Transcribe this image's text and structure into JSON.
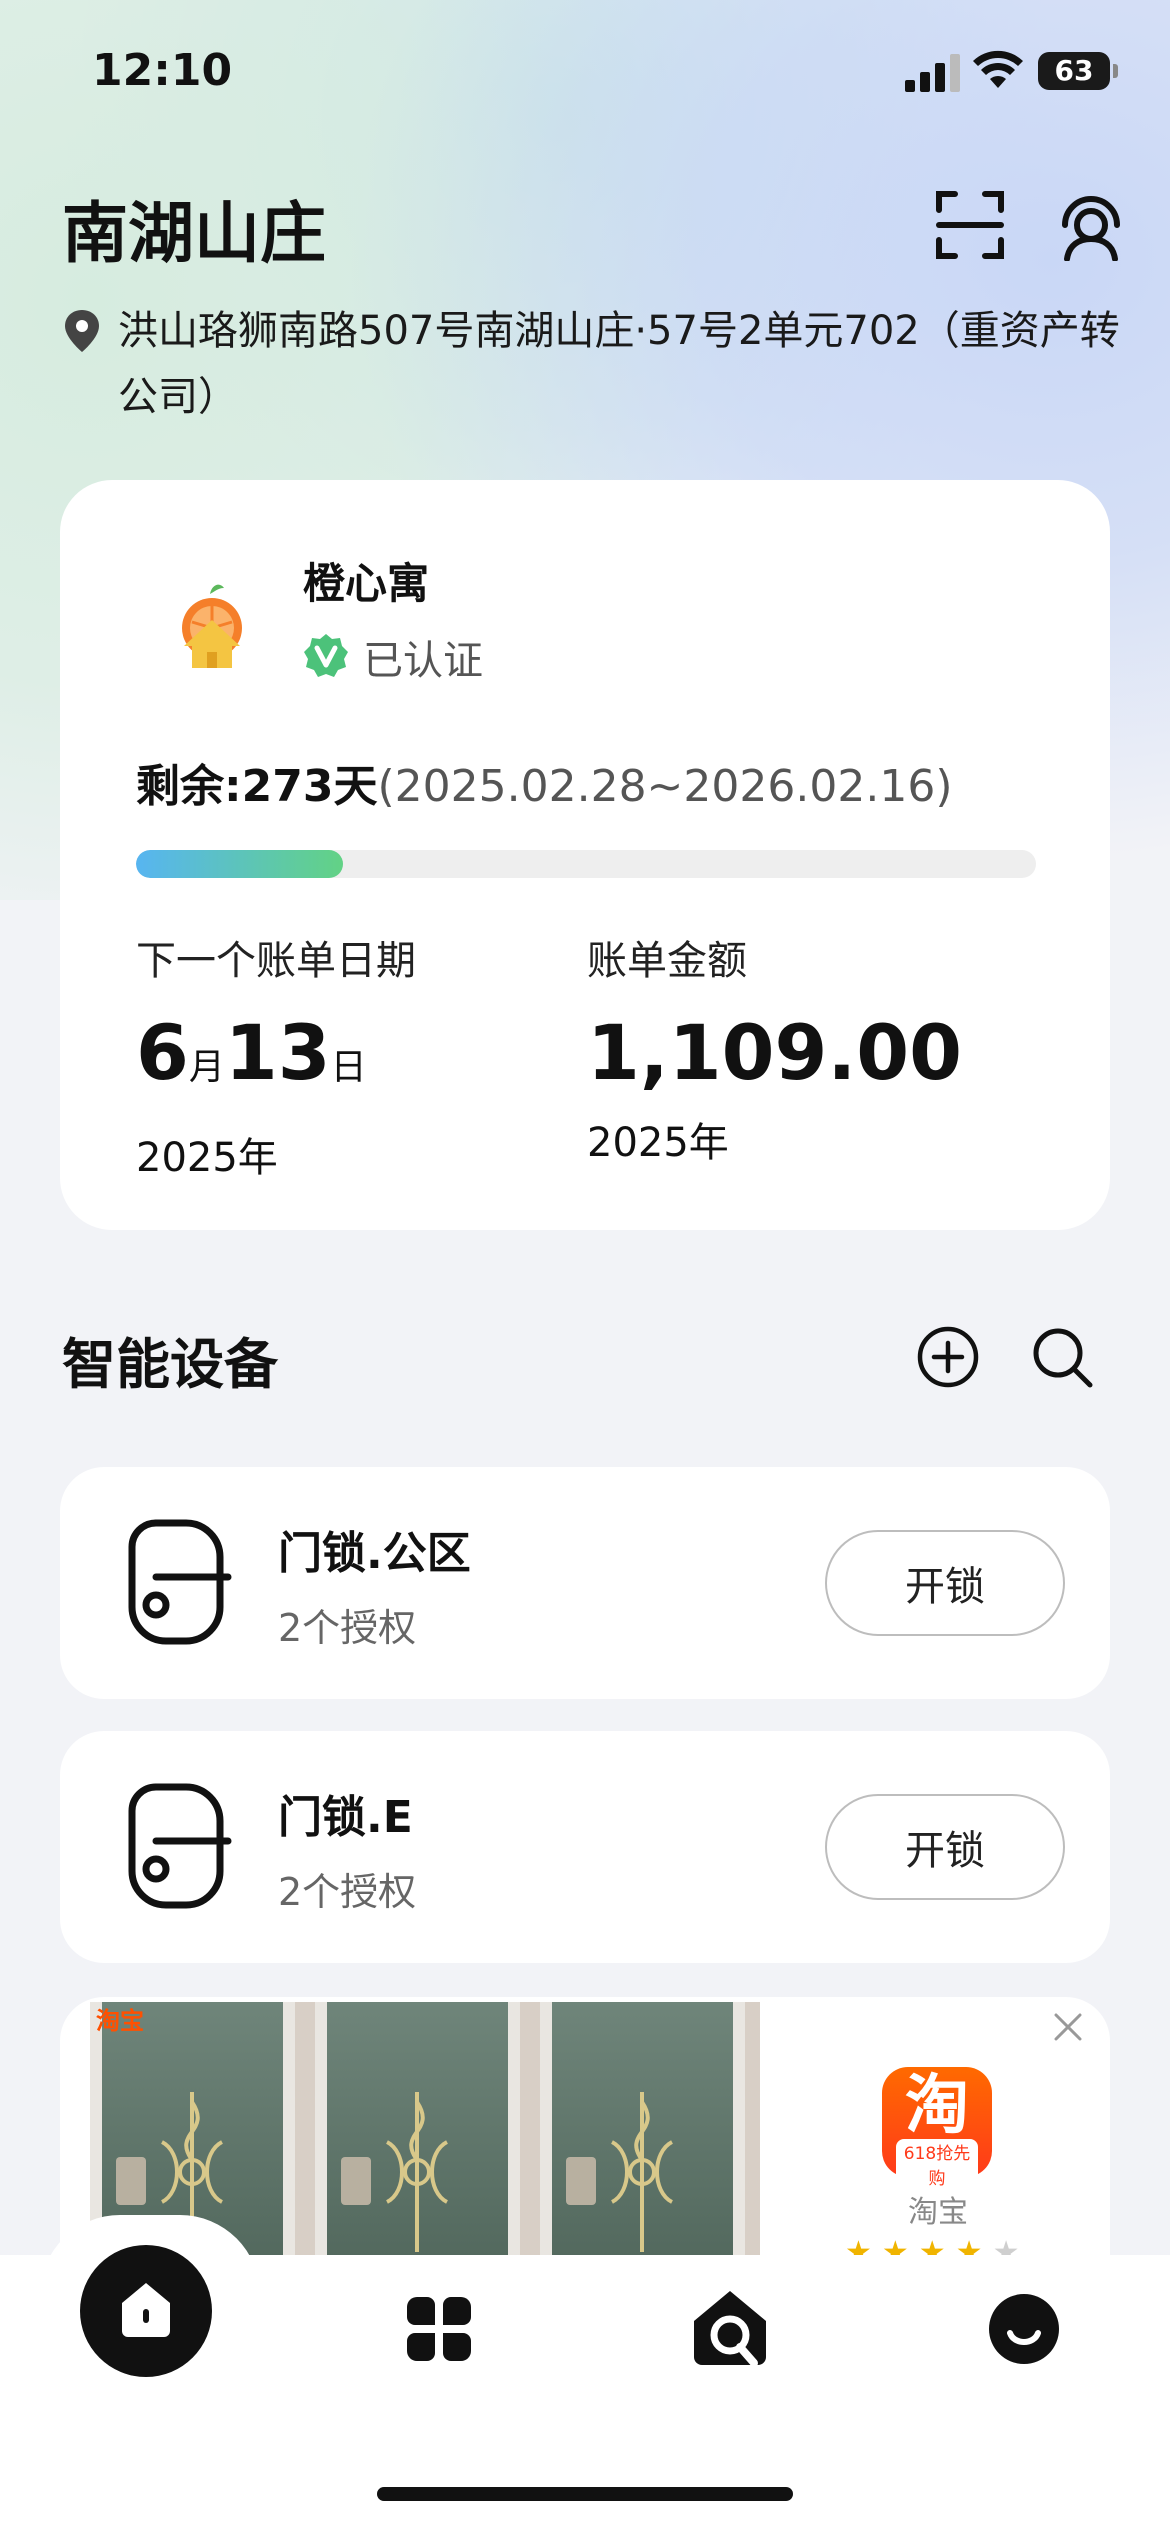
{
  "status_bar": {
    "time": "12:10",
    "battery": "63"
  },
  "header": {
    "title": "南湖山庄",
    "address": "洪山珞狮南路507号南湖山庄·57号2单元702（重资产转公司）"
  },
  "lease_card": {
    "landlord_name": "橙心寓",
    "verified_label": "已认证",
    "remaining_label": "剩余:",
    "remaining_value": "273天",
    "remaining_range": "(2025.02.28~2026.02.16)",
    "progress_fraction": 0.23,
    "next_bill_label": "下一个账单日期",
    "next_bill_month": "6",
    "month_unit": "月",
    "next_bill_day": "13",
    "day_unit": "日",
    "next_bill_year": "2025年",
    "bill_amount_label": "账单金额",
    "bill_amount": "1,109.00",
    "bill_amount_year": "2025年"
  },
  "devices_section": {
    "title": "智能设备"
  },
  "devices": [
    {
      "name": "门锁.公区",
      "subtitle": "2个授权",
      "button": "开锁"
    },
    {
      "name": "门锁.E",
      "subtitle": "2个授权",
      "button": "开锁"
    }
  ],
  "ad": {
    "source_tag": "淘宝",
    "app_icon_text": "淘",
    "app_icon_sub": "618抢先购",
    "app_name": "淘宝",
    "rating_stars": 4,
    "stars_filled": "★★★★",
    "stars_empty": "★"
  },
  "tabbar": {
    "items": [
      {
        "icon": "home-icon",
        "active": true
      },
      {
        "icon": "apps-icon",
        "active": false
      },
      {
        "icon": "smart-home-icon",
        "active": false
      },
      {
        "icon": "profile-icon",
        "active": false
      }
    ]
  }
}
